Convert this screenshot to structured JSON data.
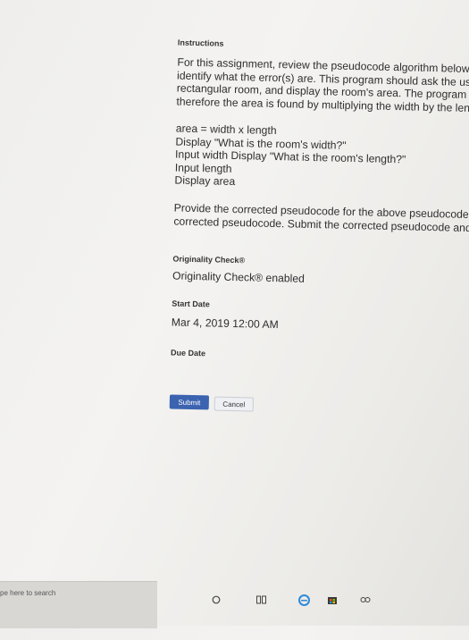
{
  "instructions": {
    "heading": "Instructions",
    "para1": [
      "For this assignment, review the pseudocode algorithm below. The algorithm has an error,",
      "identify what the error(s) are. This program should ask the user for the length and width of the",
      "rectangular room, and display the room's area.  The program assumes the room is rectangular",
      "therefore the area is found by multiplying the width by the length."
    ],
    "code": [
      "area = width x length",
      "Display \"What is the room's width?\"",
      "Input width Display \"What is the room's length?\"",
      "Input length",
      "Display area"
    ],
    "para2": [
      "Provide the corrected pseudocode for the above pseudocode. Then create a flow chart for the",
      "corrected pseudocode. Submit the corrected pseudocode and the flowchart."
    ]
  },
  "originality": {
    "label": "Originality Check®",
    "value": "Originality Check® enabled"
  },
  "start_date": {
    "label": "Start Date",
    "value": "Mar 4, 2019 12:00 AM"
  },
  "due_date": {
    "label": "Due Date"
  },
  "buttons": {
    "submit": "Submit",
    "cancel": "Cancel"
  },
  "taskbar": {
    "search_placeholder": "ype here to search"
  },
  "colors": {
    "submit_bg": "#3b63b0",
    "cancel_bg": "#eef0f4",
    "edge_icon": "#2f8ad8"
  },
  "icons": [
    "cortana-icon",
    "task-view-icon",
    "edge-browser-icon",
    "store-icon",
    "people-icon"
  ]
}
